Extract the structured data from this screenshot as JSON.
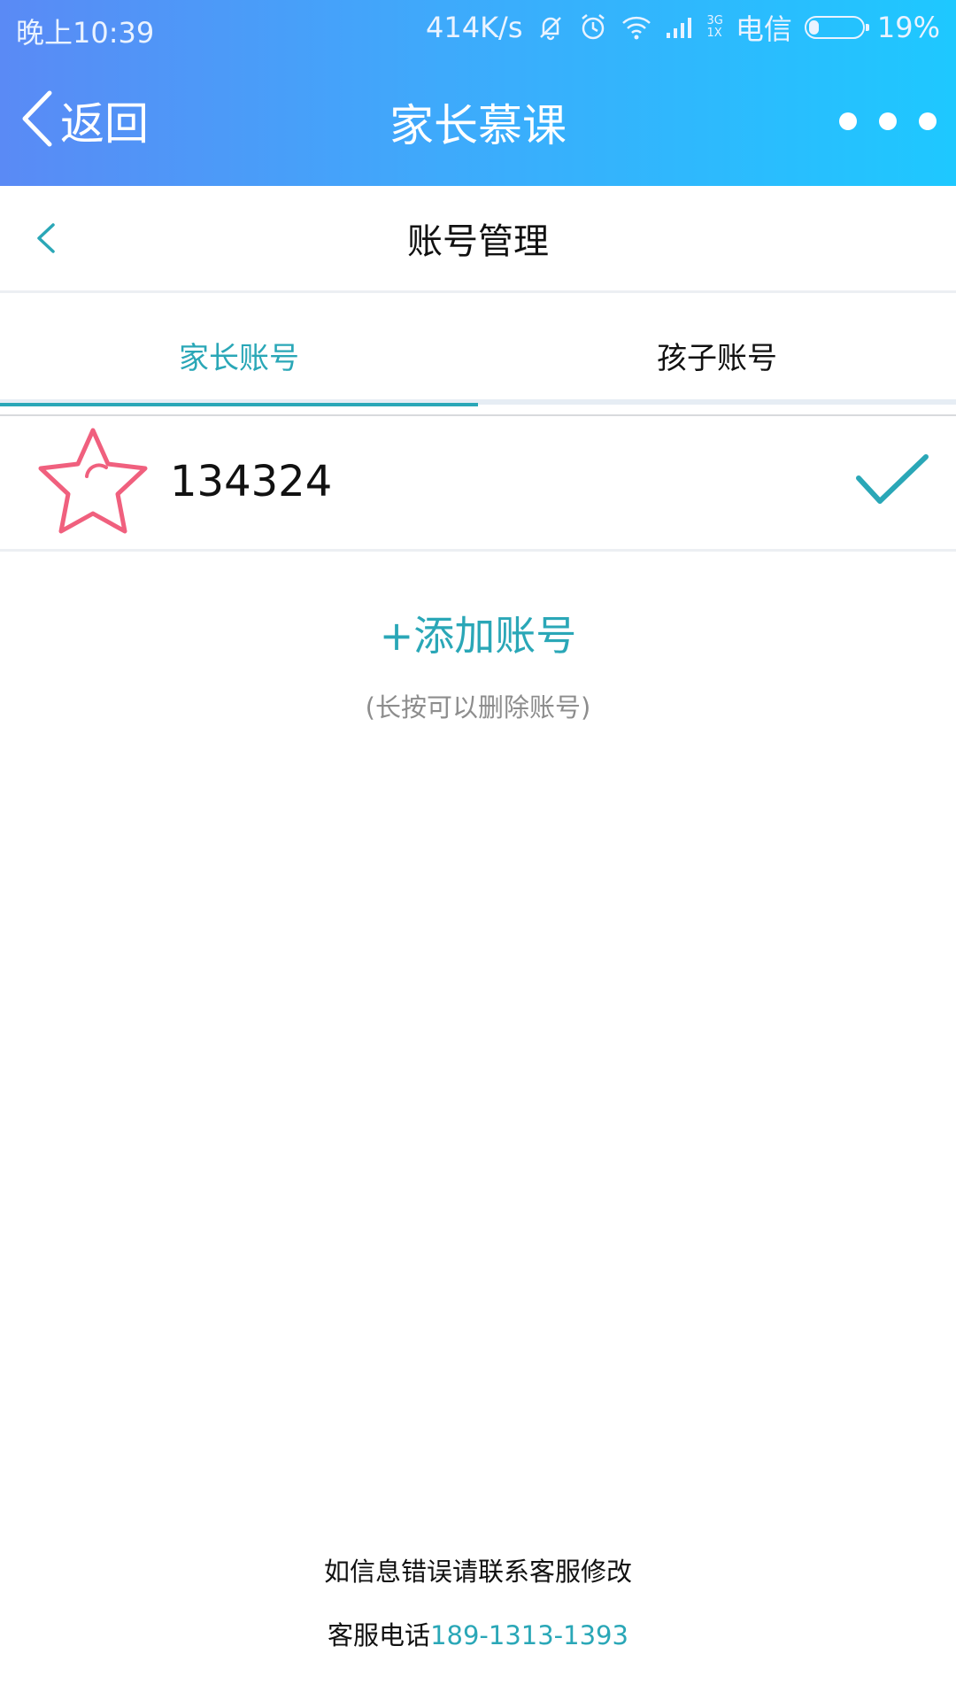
{
  "status_bar": {
    "time": "晚上10:39",
    "net_speed": "414K/s",
    "network_type_top": "3G",
    "network_type_bottom": "1X",
    "carrier": "电信",
    "battery_percent": "19%",
    "battery_level": 0.19,
    "icons": [
      "mute-bell-icon",
      "alarm-icon",
      "wifi-icon",
      "signal-icon",
      "battery-icon"
    ]
  },
  "title_bar": {
    "back_label": "返回",
    "title": "家长慕课"
  },
  "sub_header": {
    "title": "账号管理"
  },
  "tabs": [
    {
      "label": "家长账号",
      "active": true
    },
    {
      "label": "孩子账号",
      "active": false
    }
  ],
  "accounts": [
    {
      "id": "134324",
      "selected": true
    }
  ],
  "add_account_label": "+添加账号",
  "hint": "(长按可以删除账号)",
  "footer": {
    "note": "如信息错误请联系客服修改",
    "phone_prefix": "客服电话",
    "phone": "189-1313-1393"
  },
  "colors": {
    "accent": "#2aa7b7",
    "header_gradient_start": "#5a8af5",
    "header_gradient_end": "#1ec8ff",
    "avatar_star": "#f0607e"
  }
}
